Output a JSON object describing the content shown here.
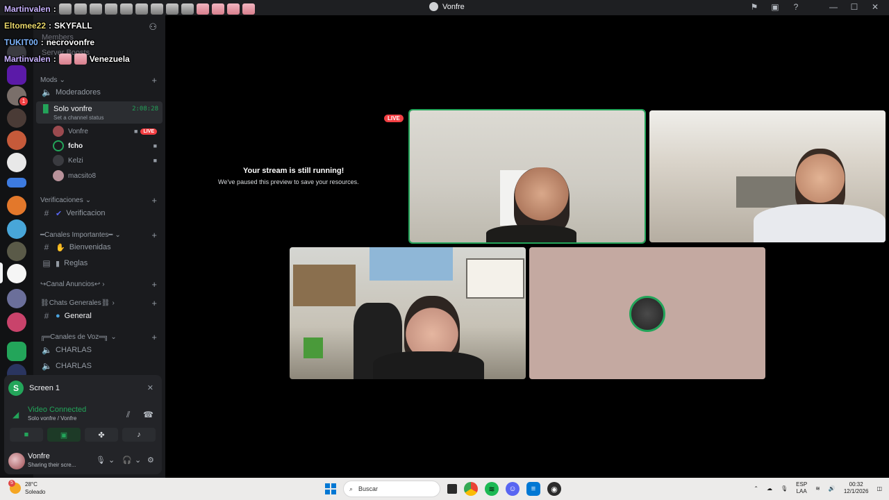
{
  "window": {
    "title": "Vonfre"
  },
  "server": {
    "name": "SKYFALL",
    "faded_items": [
      "Members",
      "Server Boosts"
    ]
  },
  "chat_overlay": [
    {
      "user": "Martinvalen",
      "sep": " : ",
      "message": ""
    },
    {
      "user": "Eltomee22",
      "sep": " : ",
      "message": ""
    },
    {
      "user": "TUKIT00",
      "sep": " : ",
      "message": "necrovonfre"
    },
    {
      "user": "Martinvalen",
      "sep": " : ",
      "message": "Venezuela"
    }
  ],
  "categories": {
    "mods": "Mods",
    "verif": "Verificaciones",
    "importantes": "━Canales Importantes━",
    "anuncios": "↪Canal Anuncios↩",
    "generales": "⛓Chats Generales⛓",
    "voz": "╔═Canales de Voz═╗"
  },
  "channels": {
    "moderadores": "Moderadores",
    "verificacion": "Verificacion",
    "bienvenidas": "Bienvenidas",
    "reglas": "Reglas",
    "general": "General",
    "charlas1": "CHARLAS",
    "charlas2": "CHARLAS"
  },
  "active_voice": {
    "name": "Solo vonfre",
    "status": "Set a channel status",
    "time": "2:08:28"
  },
  "voice_users": [
    {
      "name": "Vonfre",
      "live": "LIVE"
    },
    {
      "name": "fcho"
    },
    {
      "name": "Kelzi"
    },
    {
      "name": "macsito8"
    }
  ],
  "voice_panel": {
    "screen_label": "Screen 1",
    "connected": "Video Connected",
    "location": "Solo vonfre / Vonfre"
  },
  "user": {
    "name": "Vonfre",
    "status": "Sharing their scre..."
  },
  "stage": {
    "paused_title": "Your stream is still running!",
    "paused_sub": "We've paused this preview to save your resources.",
    "live": "LIVE"
  },
  "taskbar": {
    "temp": "28°C",
    "condition": "Soleado",
    "weather_badge": "5",
    "search": "Buscar",
    "lang1": "ESP",
    "lang2": "LAA",
    "time": "00:32",
    "date": "12/1/2026"
  },
  "colors": {
    "accent_green": "#23a55a",
    "live_red": "#f23f43"
  }
}
